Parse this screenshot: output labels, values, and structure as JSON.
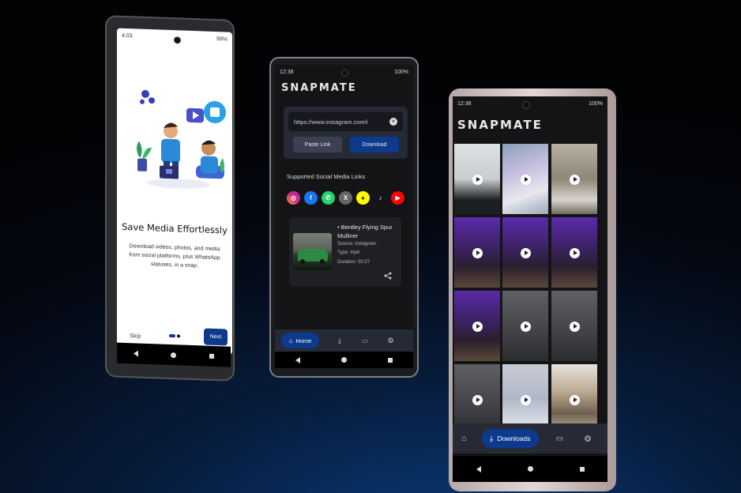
{
  "phone1": {
    "status_time": "4:03",
    "status_right": "99%",
    "title": "Save Media Effortlessly",
    "description": "Download videos, photos, and media from social platforms, plus WhatsApp statuses, in a snap.",
    "skip_label": "Skip",
    "next_label": "Next",
    "page_indicator": {
      "current": 1,
      "total": 2
    }
  },
  "phone2": {
    "status_time": "12:38",
    "status_right": "100%",
    "logo": "SNAPMATE",
    "url_value": "https://www.instagram.com/i",
    "paste_label": "Paste Link",
    "download_label": "Download",
    "supported_title": "Supported Social Media Links",
    "social_icons": [
      "instagram-icon",
      "facebook-icon",
      "whatsapp-icon",
      "x-icon",
      "snapchat-icon",
      "tiktok-icon",
      "youtube-icon"
    ],
    "media": {
      "title": "• Bentley Flying Spur Mulliner",
      "source": "Source: instagram",
      "type": "Type: mp4",
      "duration": "Duration: 00:37"
    },
    "nav": {
      "home_label": "Home"
    }
  },
  "phone3": {
    "status_time": "12:38",
    "status_right": "100%",
    "logo": "SNAPMATE",
    "nav": {
      "downloads_label": "Downloads"
    },
    "tiles": [
      "car-plate",
      "laptop",
      "building",
      "purple-room",
      "purple-room",
      "purple-room",
      "purple-room",
      "gray-scene",
      "gray-scene",
      "gray-scene",
      "laptop-hand",
      "street"
    ]
  },
  "colors": {
    "accent": "#0d3a8c",
    "dark_bg": "#141416",
    "card": "#1f2023",
    "nav_bg": "#252a36"
  }
}
